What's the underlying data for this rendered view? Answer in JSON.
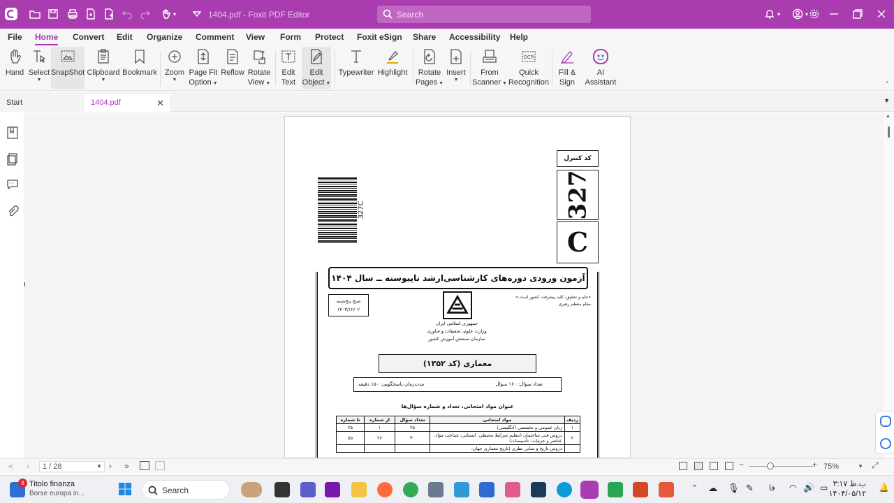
{
  "titlebar": {
    "doc_title": "1404.pdf - Foxit PDF Editor",
    "search_placeholder": "Search",
    "accent": "#a93cae"
  },
  "menu": {
    "items": [
      "File",
      "Home",
      "Convert",
      "Edit",
      "Organize",
      "Comment",
      "View",
      "Form",
      "Protect",
      "Foxit eSign",
      "Share",
      "Accessibility",
      "Help"
    ],
    "active": "Home"
  },
  "ribbon": {
    "hand": "Hand",
    "select": "Select",
    "snapshot": "SnapShot",
    "clipboard": "Clipboard",
    "bookmark": "Bookmark",
    "zoom": "Zoom",
    "pagefit_1": "Page Fit",
    "pagefit_2": "Option",
    "reflow": "Reflow",
    "rotateview_1": "Rotate",
    "rotateview_2": "View",
    "edittext_1": "Edit",
    "edittext_2": "Text",
    "editobj_1": "Edit",
    "editobj_2": "Object",
    "typewriter": "Typewriter",
    "highlight": "Highlight",
    "rotatepages_1": "Rotate",
    "rotatepages_2": "Pages",
    "insert": "Insert",
    "scanner_1": "From",
    "scanner_2": "Scanner",
    "quickrec_1": "Quick",
    "quickrec_2": "Recognition",
    "fillsign_1": "Fill &",
    "fillsign_2": "Sign",
    "ai_1": "AI",
    "ai_2": "Assistant"
  },
  "tabs": {
    "start": "Start",
    "doc": "1404.pdf"
  },
  "pdf": {
    "control_label": "کد کنترل",
    "control_number": "327",
    "control_letter": "C",
    "barcode_text": "327C",
    "exam_title": "آزمون ورودی دوره‌های کارشناسی‌ارشد ناپیوسته ــ سال ۱۴۰۴",
    "date_line1": "صبح پنج‌شنبه",
    "date_line2": "۱۴۰۳/۱۲/۰۲",
    "quote_line1": "«علم و تحقیق، کلید پیشرفت کشور است.»",
    "quote_line2": "مقام معظم رهبری",
    "org_line1": "جمهوری اسلامی ایران",
    "org_line2": "وزارت علوم، تحقیقات و فناوری",
    "org_line3": "سازمان سنجش آموزش کشور",
    "field_title": "معماری (کد ۱۳۵۲)",
    "question_count": "تعداد سؤال: ۱۶۰ سؤال",
    "duration": "مدت‌زمان پاسخگویی: ۱۵۰ دقیقه",
    "table_title": "عنوان مواد امتحانی، تعداد و شماره سؤال‌ها",
    "table_headers": [
      "ردیف",
      "مواد امتحانی",
      "تعداد سؤال",
      "از شماره",
      "تا شماره"
    ],
    "table_rows": [
      [
        "۱",
        "زبان عمومی و تخصصی (انگلیسی)",
        "۲۵",
        "۱",
        "۲۵"
      ],
      [
        "۲",
        "دروس فنی ساختمان (تنظیم شرایط محیطی، ایستایی، شناخت مواد، عناصر و جزئیات، تأسیسات)",
        "۳۰",
        "۲۶",
        "۵۵"
      ],
      [
        "",
        "دروس تاریخ و مبانی نظری (تاریخ معماری جهان،",
        "",
        "",
        ""
      ]
    ]
  },
  "status": {
    "page": "1 / 28",
    "zoom": "75%"
  },
  "taskbar": {
    "widget_title": "Titolo finanza",
    "widget_sub": "Borse europa in...",
    "widget_badge": "8",
    "search": "Search",
    "lang": "فا",
    "time": "۳:۱۷ ب.ظ",
    "date": "۱۴۰۴/۰۵/۱۲"
  }
}
